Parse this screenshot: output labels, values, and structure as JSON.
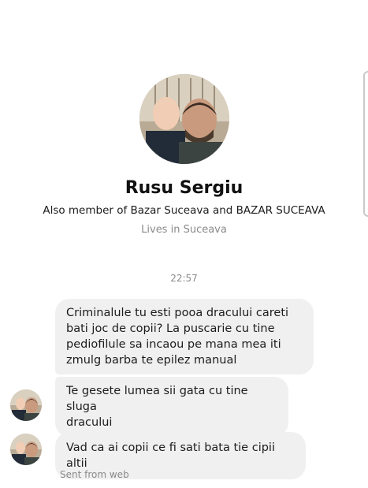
{
  "profile": {
    "name": "Rusu Sergiu",
    "member_text": "Also member of Bazar Suceava and BAZAR SUCEAVA",
    "location_text": "Lives in Suceava"
  },
  "conversation": {
    "timestamp": "22:57",
    "messages": [
      {
        "lines": [
          "Criminalule tu esti pooa dracului careti",
          "bati joc de copii? La puscarie cu tine",
          "pediofilule sa incaou pe mana mea iti",
          "zmulg barba te epilez manual"
        ]
      },
      {
        "lines": [
          "Te gesete lumea sii gata cu tine sluga",
          "dracului"
        ]
      },
      {
        "lines": [
          "Vad ca ai copii ce fi sati bata tie cipii altii"
        ]
      }
    ],
    "status": "Sent from web"
  },
  "colors": {
    "bubble_bg": "#f1f0f0",
    "secondary_text": "#8a8a8a"
  }
}
